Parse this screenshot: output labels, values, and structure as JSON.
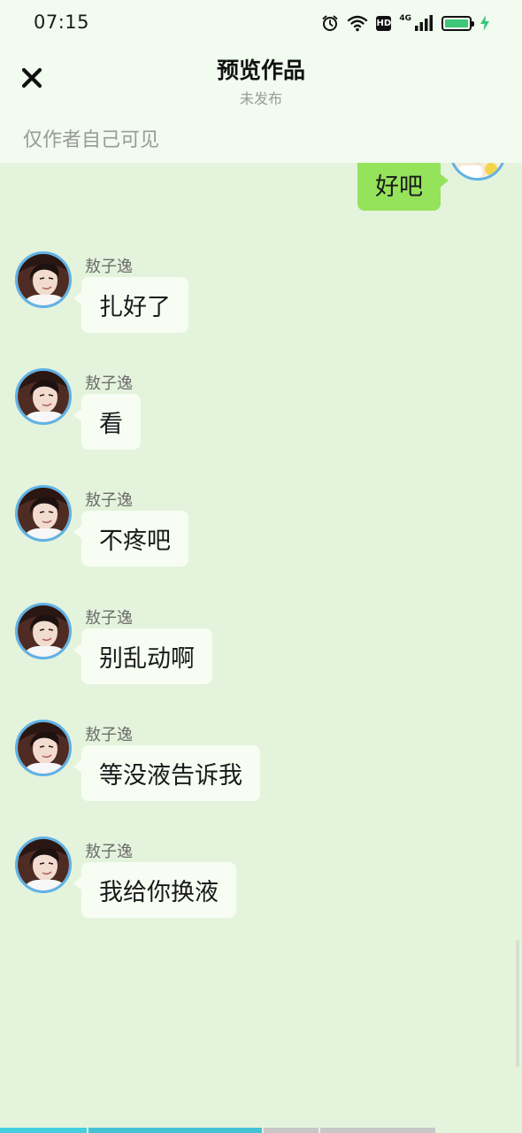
{
  "status_bar": {
    "time": "07:15",
    "network_label": "4G",
    "hd_label": "HD",
    "battery_level": 1.0,
    "battery_color": "#3ec67a",
    "icons": [
      "alarm-icon",
      "wifi-icon",
      "hd-icon",
      "signal-icon",
      "battery-icon",
      "charging-icon"
    ]
  },
  "header": {
    "close_icon": "close-icon",
    "title": "预览作品",
    "subtitle": "未发布",
    "visibility_note": "仅作者自己可见"
  },
  "chat": {
    "self_message": {
      "text": "好吧",
      "bubble_color": "#95e25b"
    },
    "messages": [
      {
        "sender": "敖子逸",
        "text": "扎好了"
      },
      {
        "sender": "敖子逸",
        "text": "看"
      },
      {
        "sender": "敖子逸",
        "text": "不疼吧"
      },
      {
        "sender": "敖子逸",
        "text": "别乱动啊"
      },
      {
        "sender": "敖子逸",
        "text": "等没液告诉我"
      },
      {
        "sender": "敖子逸",
        "text": "我给你换液"
      }
    ]
  },
  "colors": {
    "chat_background": "#e4f3dc",
    "header_background": "#f1fbef",
    "avatar_ring": "#5fb2e6"
  }
}
